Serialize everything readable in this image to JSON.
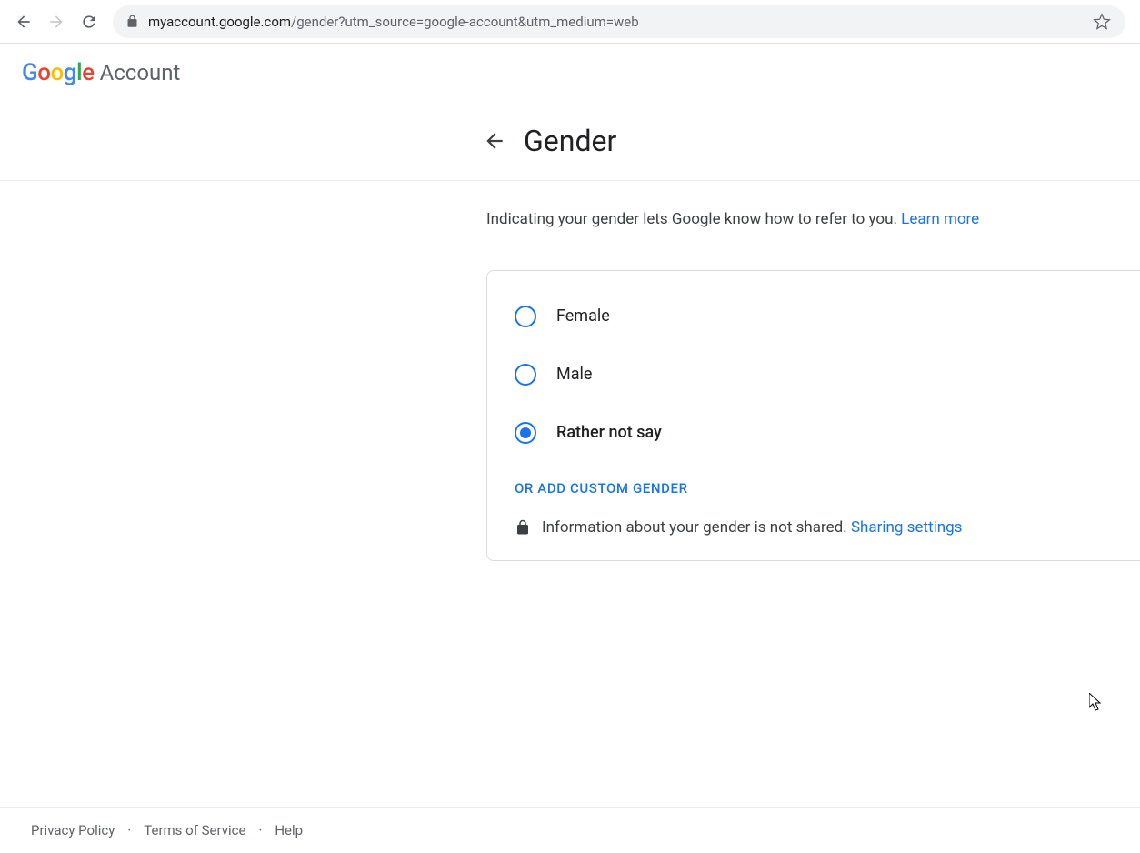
{
  "browser": {
    "url_domain": "myaccount.google.com",
    "url_path": "/gender?utm_source=google-account&utm_medium=web"
  },
  "header": {
    "logo": {
      "l1": "G",
      "l2": "o",
      "l3": "o",
      "l4": "g",
      "l5": "l",
      "l6": "e"
    },
    "product": "Account"
  },
  "page": {
    "title": "Gender",
    "description": "Indicating your gender lets Google know how to refer to you. ",
    "learn_more": "Learn more"
  },
  "options": [
    {
      "label": "Female",
      "selected": false
    },
    {
      "label": "Male",
      "selected": false
    },
    {
      "label": "Rather not say",
      "selected": true
    }
  ],
  "custom_link": "Or add custom gender",
  "info": {
    "text": "Information about your gender is not shared. ",
    "link": "Sharing settings"
  },
  "footer": {
    "privacy": "Privacy Policy",
    "terms": "Terms of Service",
    "help": "Help"
  }
}
